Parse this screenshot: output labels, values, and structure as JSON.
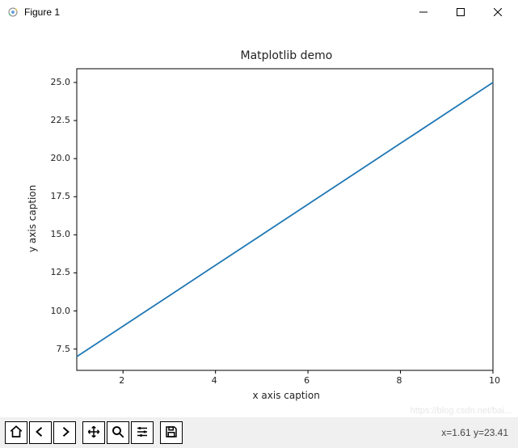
{
  "window": {
    "title": "Figure 1",
    "controls": {
      "minimize": "minimize",
      "maximize": "maximize",
      "close": "close"
    }
  },
  "chart_data": {
    "type": "line",
    "title": "Matplotlib demo",
    "xlabel": "x axis caption",
    "ylabel": "y axis caption",
    "x": [
      1,
      2,
      3,
      4,
      5,
      6,
      7,
      8,
      9,
      10
    ],
    "y": [
      7,
      9,
      11,
      13,
      15,
      17,
      19,
      21,
      23,
      25
    ],
    "xlim": [
      1,
      10
    ],
    "ylim": [
      7,
      25
    ],
    "xticks": [
      2,
      4,
      6,
      8,
      10
    ],
    "yticks": [
      7.5,
      10.0,
      12.5,
      15.0,
      17.5,
      20.0,
      22.5,
      25.0
    ],
    "line_color": "#1f77b4"
  },
  "toolbar": {
    "buttons": {
      "home": "home-icon",
      "back": "back-icon",
      "forward": "forward-icon",
      "pan": "pan-icon",
      "zoom": "zoom-icon",
      "configure": "configure-subplots-icon",
      "save": "save-figure-icon"
    },
    "coord_readout": "x=1.61 y=23.41"
  },
  "watermark": "https://blog.csdn.net/bai..."
}
